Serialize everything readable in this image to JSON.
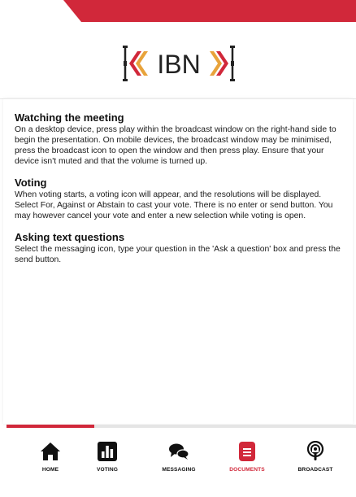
{
  "colors": {
    "accent": "#d1283a",
    "text": "#111111",
    "logo_gold": "#e8a33b",
    "logo_dark": "#222222"
  },
  "logo": {
    "text": "IBN"
  },
  "sections": [
    {
      "heading": "Watching the meeting",
      "body": "On a desktop device, press play within the broadcast window on the right-hand side to begin the presentation. On mobile devices, the broadcast window may be minimised, press the broadcast icon to open the window and then press play. Ensure that your device isn't muted and that the volume is turned up."
    },
    {
      "heading": "Voting",
      "body": "When voting starts, a voting icon will appear, and the resolutions will be displayed. Select For, Against or Abstain to cast your vote. There is no enter or send button. You may however cancel your vote and enter a new selection while voting is open."
    },
    {
      "heading": "Asking text questions",
      "body": "Select the messaging icon, type your question in the 'Ask a question' box and press the send button."
    }
  ],
  "progress": {
    "fraction": 0.25
  },
  "nav": {
    "active": "documents",
    "items": [
      {
        "id": "home",
        "label": "HOME",
        "icon": "home-icon"
      },
      {
        "id": "voting",
        "label": "VOTING",
        "icon": "bar-chart-icon"
      },
      {
        "id": "messaging",
        "label": "MESSAGING",
        "icon": "chat-bubbles-icon"
      },
      {
        "id": "documents",
        "label": "DOCUMENTS",
        "icon": "document-icon"
      },
      {
        "id": "broadcast",
        "label": "BROADCAST",
        "icon": "podcast-icon"
      }
    ]
  }
}
